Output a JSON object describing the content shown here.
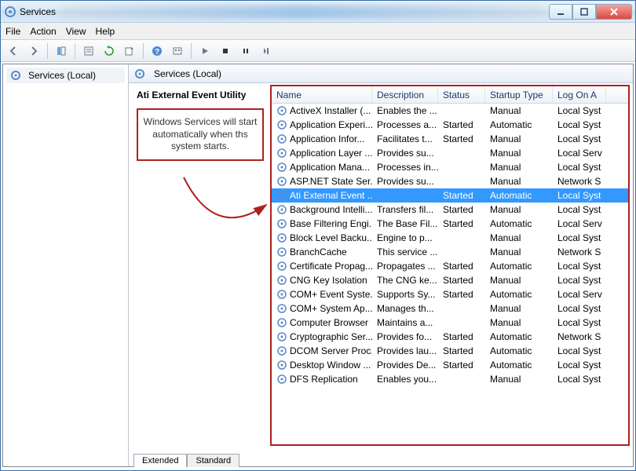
{
  "window": {
    "title": "Services"
  },
  "menu": {
    "file": "File",
    "action": "Action",
    "view": "View",
    "help": "Help"
  },
  "tree": {
    "root": "Services (Local)"
  },
  "rightHeader": {
    "title": "Services (Local)"
  },
  "detail": {
    "serviceName": "Ati External Event Utility",
    "annotation": "Windows Services will start automatically when ths system starts."
  },
  "columns": {
    "name": "Name",
    "description": "Description",
    "status": "Status",
    "startup": "Startup Type",
    "logon": "Log On A"
  },
  "services": [
    {
      "name": "ActiveX Installer (...",
      "desc": "Enables the ...",
      "status": "",
      "startup": "Manual",
      "logon": "Local Syst"
    },
    {
      "name": "Application Experi...",
      "desc": "Processes a...",
      "status": "Started",
      "startup": "Automatic",
      "logon": "Local Syst"
    },
    {
      "name": "Application Infor...",
      "desc": "Facilitates t...",
      "status": "Started",
      "startup": "Manual",
      "logon": "Local Syst"
    },
    {
      "name": "Application Layer ...",
      "desc": "Provides su...",
      "status": "",
      "startup": "Manual",
      "logon": "Local Serv"
    },
    {
      "name": "Application Mana...",
      "desc": "Processes in...",
      "status": "",
      "startup": "Manual",
      "logon": "Local Syst"
    },
    {
      "name": "ASP.NET State Ser...",
      "desc": "Provides su...",
      "status": "",
      "startup": "Manual",
      "logon": "Network S"
    },
    {
      "name": "Ati External Event ...",
      "desc": "",
      "status": "Started",
      "startup": "Automatic",
      "logon": "Local Syst",
      "selected": true
    },
    {
      "name": "Background Intelli...",
      "desc": "Transfers fil...",
      "status": "Started",
      "startup": "Manual",
      "logon": "Local Syst"
    },
    {
      "name": "Base Filtering Engi...",
      "desc": "The Base Fil...",
      "status": "Started",
      "startup": "Automatic",
      "logon": "Local Serv"
    },
    {
      "name": "Block Level Backu...",
      "desc": "Engine to p...",
      "status": "",
      "startup": "Manual",
      "logon": "Local Syst"
    },
    {
      "name": "BranchCache",
      "desc": "This service ...",
      "status": "",
      "startup": "Manual",
      "logon": "Network S"
    },
    {
      "name": "Certificate Propag...",
      "desc": "Propagates ...",
      "status": "Started",
      "startup": "Automatic",
      "logon": "Local Syst"
    },
    {
      "name": "CNG Key Isolation",
      "desc": "The CNG ke...",
      "status": "Started",
      "startup": "Manual",
      "logon": "Local Syst"
    },
    {
      "name": "COM+ Event Syste...",
      "desc": "Supports Sy...",
      "status": "Started",
      "startup": "Automatic",
      "logon": "Local Serv"
    },
    {
      "name": "COM+ System Ap...",
      "desc": "Manages th...",
      "status": "",
      "startup": "Manual",
      "logon": "Local Syst"
    },
    {
      "name": "Computer Browser",
      "desc": "Maintains a...",
      "status": "",
      "startup": "Manual",
      "logon": "Local Syst"
    },
    {
      "name": "Cryptographic Ser...",
      "desc": "Provides fo...",
      "status": "Started",
      "startup": "Automatic",
      "logon": "Network S"
    },
    {
      "name": "DCOM Server Proc...",
      "desc": "Provides lau...",
      "status": "Started",
      "startup": "Automatic",
      "logon": "Local Syst"
    },
    {
      "name": "Desktop Window ...",
      "desc": "Provides De...",
      "status": "Started",
      "startup": "Automatic",
      "logon": "Local Syst"
    },
    {
      "name": "DFS Replication",
      "desc": "Enables you...",
      "status": "",
      "startup": "Manual",
      "logon": "Local Syst"
    }
  ],
  "tabs": {
    "extended": "Extended",
    "standard": "Standard"
  }
}
